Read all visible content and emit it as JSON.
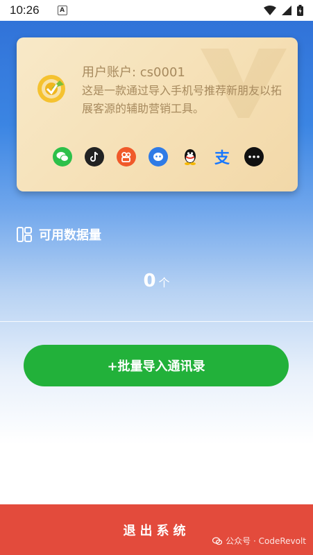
{
  "status_bar": {
    "time": "10:26",
    "notification_letter": "A"
  },
  "card": {
    "user_line": "用户账户: cs0001",
    "description": "这是一款通过导入手机号推荐新朋友以拓展客源的辅助营销工具。",
    "apps": [
      {
        "name": "wechat-icon",
        "color": "#2dc04a"
      },
      {
        "name": "tiktok-icon",
        "color": "#222222"
      },
      {
        "name": "kuaishou-icon",
        "color": "#f0592a"
      },
      {
        "name": "blue-chat-icon",
        "color": "#2f7be6"
      },
      {
        "name": "qq-icon",
        "color": "#ffffff"
      },
      {
        "name": "alipay-icon",
        "color": "#ffffff"
      },
      {
        "name": "more-icon",
        "color": "#111111"
      }
    ]
  },
  "data_section": {
    "title": "可用数据量",
    "count": "0",
    "unit": "个"
  },
  "import_button": {
    "label": "+批量导入通讯录"
  },
  "logout": {
    "label": "退出系统"
  },
  "watermark": {
    "text": "公众号 · CodeRevolt"
  },
  "colors": {
    "accent_green": "#22b13a",
    "logout_red": "#e34b3c",
    "card_text": "#a78a5e"
  }
}
